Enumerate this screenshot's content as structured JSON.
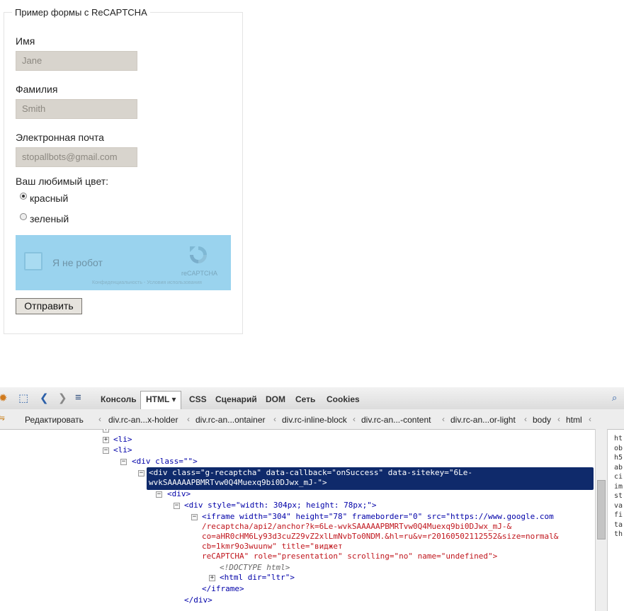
{
  "form": {
    "legend": "Пример формы с ReCAPTCHA",
    "first_name_label": "Имя",
    "first_name_value": "Jane",
    "last_name_label": "Фамилия",
    "last_name_value": "Smith",
    "email_label": "Электронная почта",
    "email_value": "stopallbots@gmail.com",
    "color_label": "Ваш любимый цвет:",
    "color_options": [
      "красный",
      "зеленый"
    ],
    "color_selected": "красный",
    "captcha": {
      "checkbox_label": "Я не робот",
      "brand": "reCAPTCHA",
      "privacy": "Конфиденциальность - Условия использования"
    },
    "submit_label": "Отправить"
  },
  "devtools": {
    "tabs": [
      "Консоль",
      "HTML ▾",
      "CSS",
      "Сценарий",
      "DOM",
      "Сеть",
      "Cookies"
    ],
    "active_tab": "HTML ▾",
    "edit_button": "Редактировать",
    "breadcrumbs": [
      "div.rc-an...x-holder",
      "div.rc-an...ontainer",
      "div.rc-inline-block",
      "div.rc-an...-content",
      "div.rc-an...or-light",
      "body",
      "html"
    ],
    "side_panel": [
      "ht",
      "ob",
      "h5",
      "ab",
      "ci",
      "im",
      "st",
      "va",
      "fi",
      "ta",
      "th"
    ],
    "code": {
      "l1": "<li>",
      "l2": "<li>",
      "l3": "<div class=\"\">",
      "sel1": "<div class=\"g-recaptcha\" data-callback=\"onSuccess\" data-sitekey=\"6Le-",
      "sel2": "wvkSAAAAAPBMRTvw0Q4Muexq9bi0DJwx_mJ-\">",
      "l5": "<div>",
      "l6": "<div style=\"width: 304px; height: 78px;\">",
      "l7": "<iframe width=\"304\" height=\"78\" frameborder=\"0\" src=\"https://www.google.com",
      "l8": "/recaptcha/api2/anchor?k=6Le-wvkSAAAAAPBMRTvw0Q4Muexq9bi0DJwx_mJ-&",
      "l9": "co=aHR0cHM6Ly93d3cuZ29vZ2xlLmNvbTo0NDM.&hl=ru&v=r20160502112552&size=normal&",
      "l10": "cb=1kmr9o3wuunw\" title=\"виджет",
      "l11": "reCAPTCHA\" role=\"presentation\" scrolling=\"no\" name=\"undefined\">",
      "l12": "<!DOCTYPE html>",
      "l13": "<html dir=\"ltr\">",
      "l14": "</iframe>",
      "l15": "</div>"
    },
    "colors": {
      "selection": "#0f2a6b",
      "tag": "#0000a8",
      "value": "#c0161d"
    }
  }
}
